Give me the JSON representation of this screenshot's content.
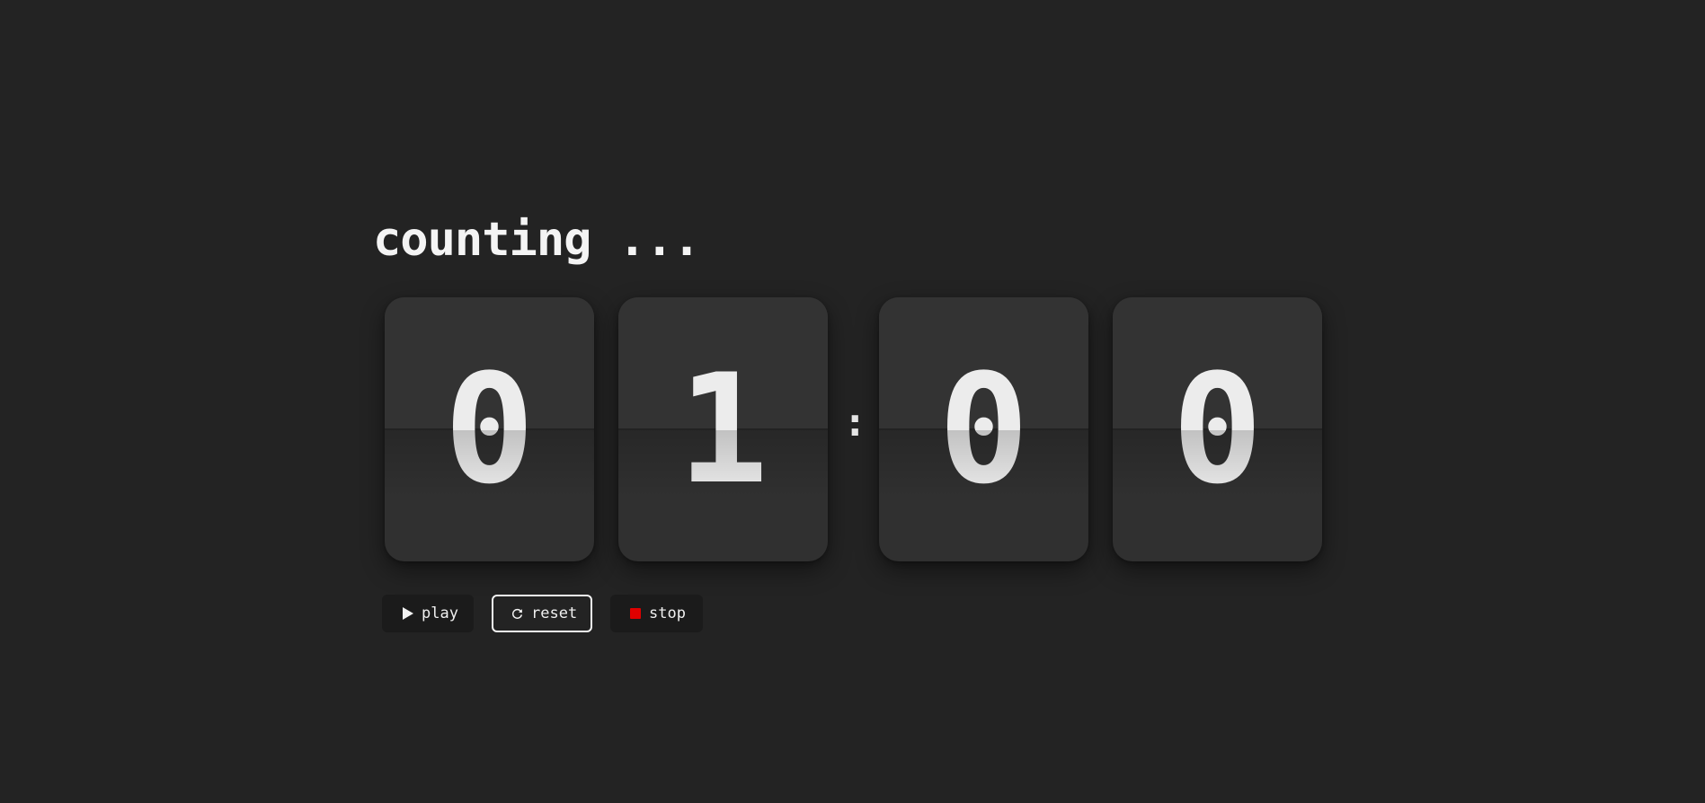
{
  "status": {
    "title": "counting ..."
  },
  "clock": {
    "hours_tens": "0",
    "hours_ones": "1",
    "separator": ":",
    "minutes_tens": "0",
    "minutes_ones": "0"
  },
  "controls": {
    "play": {
      "label": "play",
      "icon": "play-icon"
    },
    "reset": {
      "label": "reset",
      "icon": "refresh-icon"
    },
    "stop": {
      "label": "stop",
      "icon": "stop-icon",
      "icon_color": "#e00000"
    }
  },
  "colors": {
    "background": "#232323",
    "card": "#303030",
    "digit": "#ececec",
    "button_bg": "#1b1b1b"
  }
}
